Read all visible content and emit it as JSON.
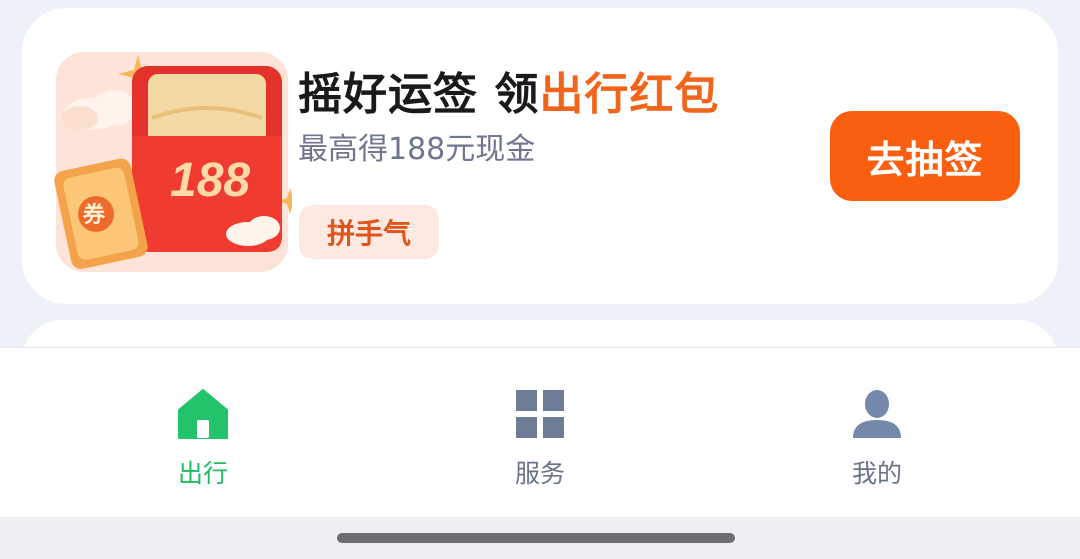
{
  "promo": {
    "title_part1": "摇好运签 领",
    "title_highlight": "出行红包",
    "subtitle": "最高得188元现金",
    "tag": "拼手气",
    "button_label": "去抽签",
    "art_amount": "188",
    "art_coupon_char": "券",
    "art_icon": "red-envelope-illustration",
    "colors": {
      "highlight": "#f26419",
      "button": "#fa5f0f",
      "tag_bg": "#fde9e2"
    }
  },
  "tab_bar": {
    "items": [
      {
        "label": "出行",
        "icon": "home-icon",
        "active": true
      },
      {
        "label": "服务",
        "icon": "grid-icon",
        "active": false
      },
      {
        "label": "我的",
        "icon": "user-icon",
        "active": false
      }
    ],
    "colors": {
      "active": "#20ba62",
      "inactive": "#6a7489"
    }
  }
}
